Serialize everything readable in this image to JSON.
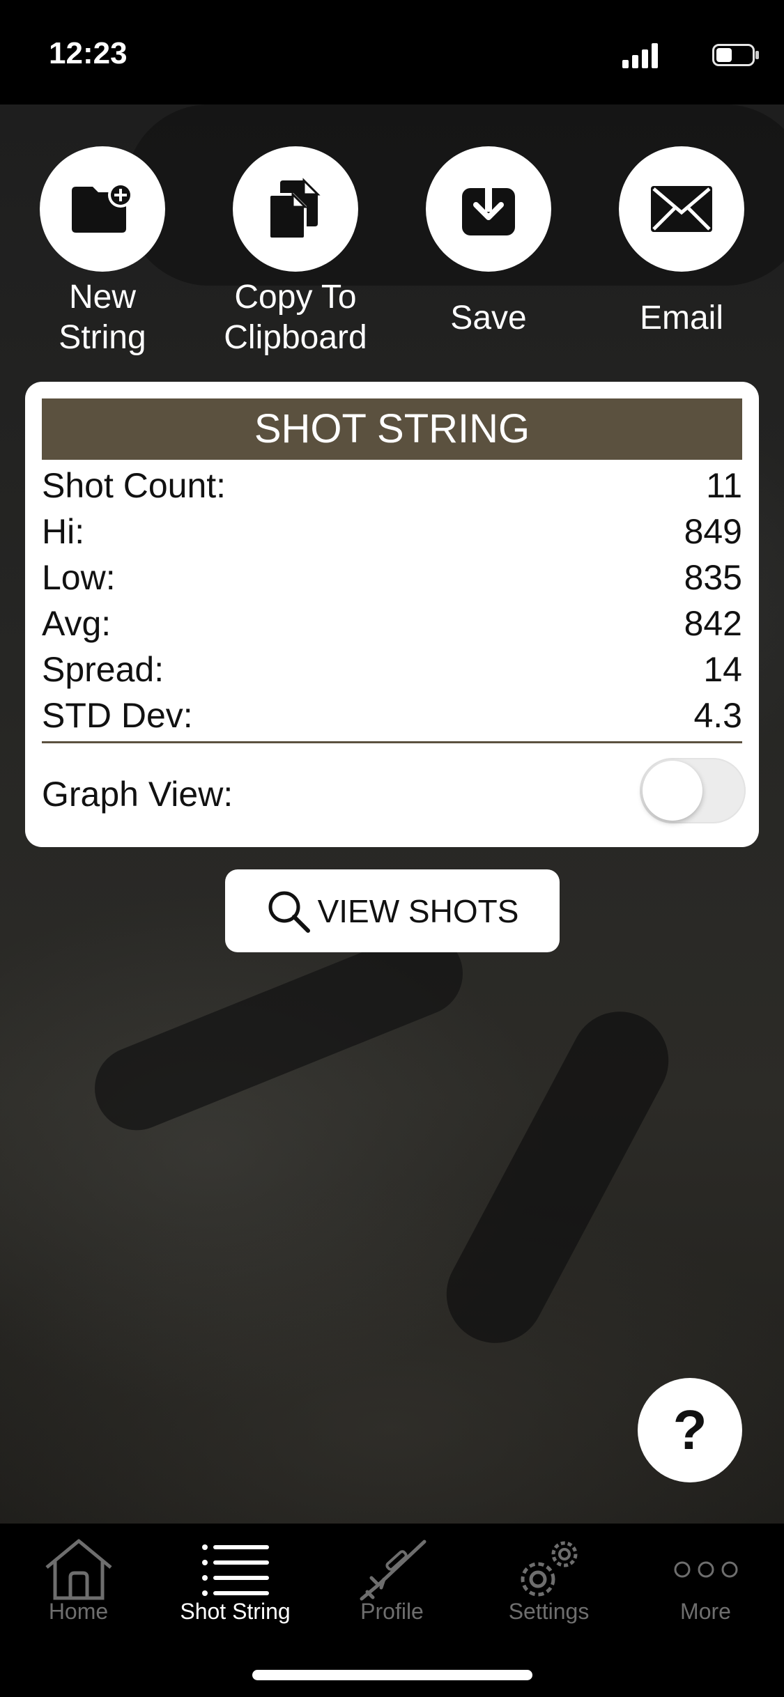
{
  "status_bar": {
    "time": "12:23"
  },
  "actions": [
    {
      "label_line1": "New",
      "label_line2": "String",
      "icon": "folder-plus-icon"
    },
    {
      "label_line1": "Copy To",
      "label_line2": "Clipboard",
      "icon": "copy-icon"
    },
    {
      "label": "Save",
      "icon": "save-icon"
    },
    {
      "label": "Email",
      "icon": "envelope-icon"
    }
  ],
  "card": {
    "title": "SHOT STRING",
    "stats": [
      {
        "label": "Shot Count:",
        "value": "11"
      },
      {
        "label": "Hi:",
        "value": "849"
      },
      {
        "label": "Low:",
        "value": "835"
      },
      {
        "label": "Avg:",
        "value": "842"
      },
      {
        "label": "Spread:",
        "value": "14"
      },
      {
        "label": "STD Dev:",
        "value": "4.3"
      }
    ],
    "graph_view_label": "Graph View:",
    "graph_view_on": false
  },
  "view_shots_label": "VIEW SHOTS",
  "help_label": "?",
  "tabs": [
    {
      "label": "Home",
      "icon": "home-icon",
      "active": false
    },
    {
      "label": "Shot String",
      "icon": "list-icon",
      "active": true
    },
    {
      "label": "Profile",
      "icon": "rifle-icon",
      "active": false
    },
    {
      "label": "Settings",
      "icon": "gears-icon",
      "active": false
    },
    {
      "label": "More",
      "icon": "more-icon",
      "active": false
    }
  ],
  "colors": {
    "accent": "#5b513f",
    "active_tab": "#ffffff",
    "inactive_tab": "#6e6e6e"
  }
}
